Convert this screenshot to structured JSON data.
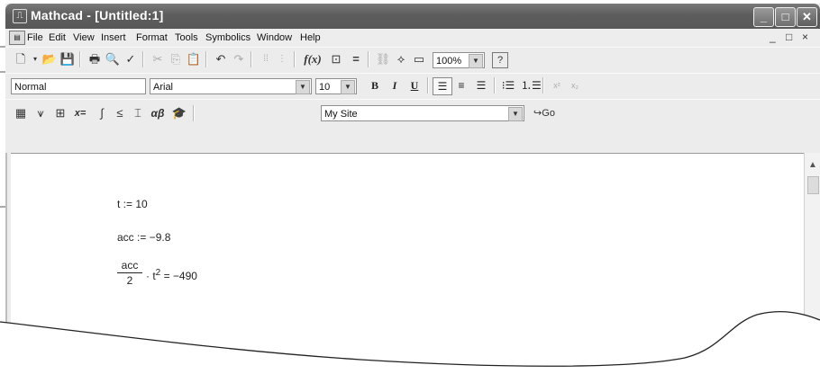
{
  "window": {
    "title": "Mathcad - [Untitled:1]"
  },
  "menu": {
    "items": [
      "File",
      "Edit",
      "View",
      "Insert",
      "Format",
      "Tools",
      "Symbolics",
      "Window",
      "Help"
    ],
    "doc_controls": [
      "_",
      "□",
      "×"
    ]
  },
  "standard_toolbar": {
    "zoom": "100%"
  },
  "formatting_toolbar": {
    "style": "Normal",
    "font": "Arial",
    "size": "10",
    "bold": "B",
    "italic": "I",
    "underline": "U"
  },
  "math_toolbar": {
    "resource_combo": "My Site",
    "go_label": "Go",
    "evaluate_symbol": "x=",
    "greek_symbol": "αβ"
  },
  "worksheet": {
    "line1": "t := 10",
    "line2": "acc := −9.8",
    "expr_numerator": "acc",
    "expr_denominator": "2",
    "expr_rest": "· t",
    "expr_exponent": "2",
    "expr_result": "= −490"
  }
}
